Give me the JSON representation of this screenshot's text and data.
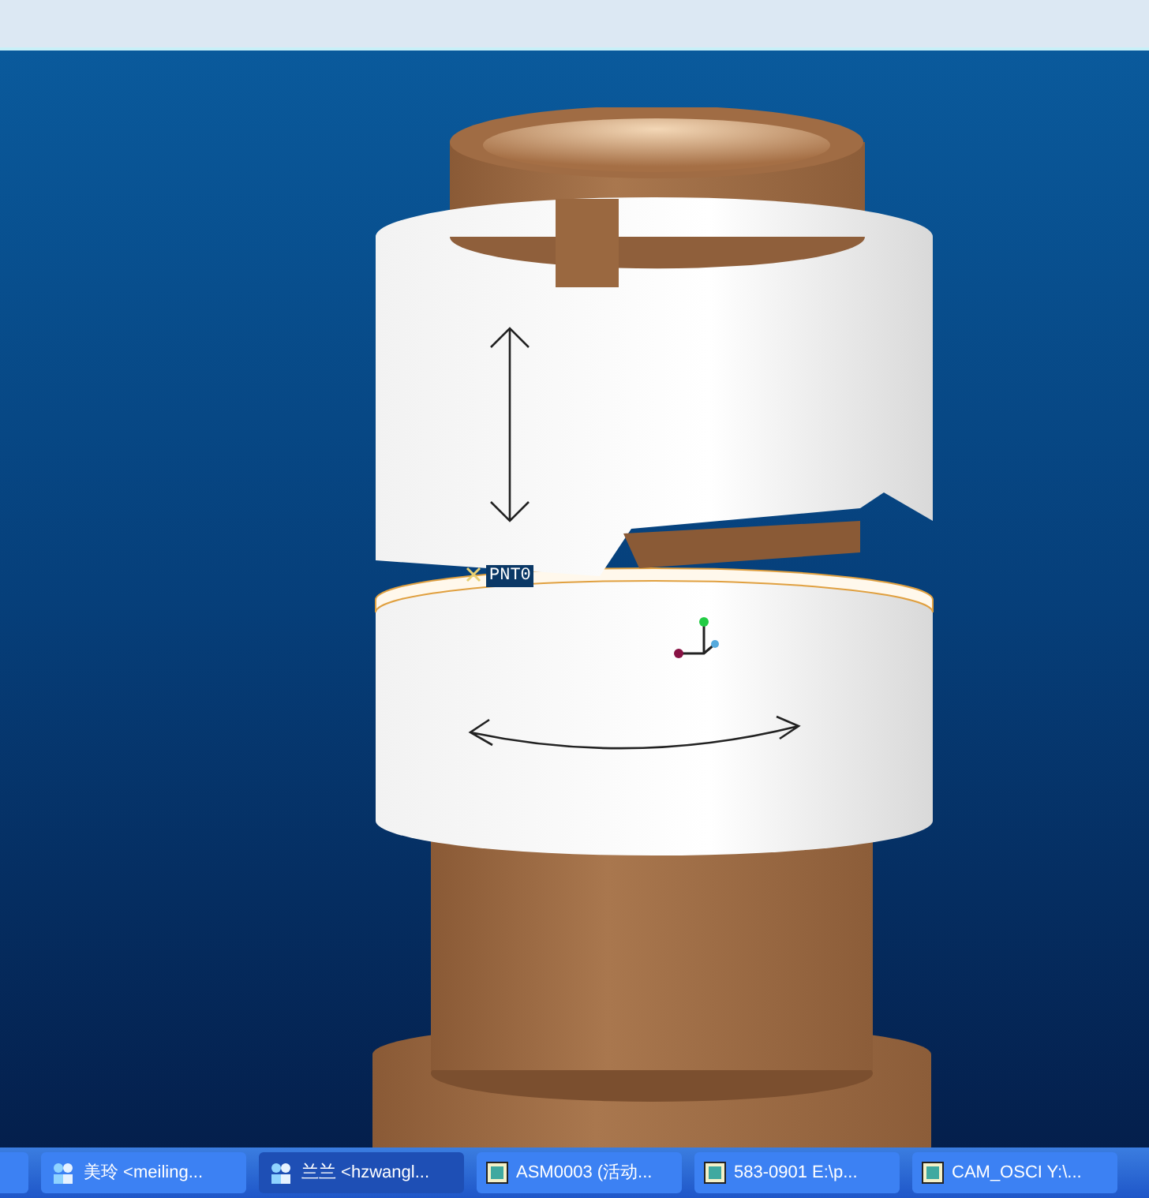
{
  "viewport": {
    "point_label": "PNT0"
  },
  "taskbar": {
    "items": [
      {
        "kind": "partial"
      },
      {
        "label": "美玲 <meiling...",
        "kind": "chat"
      },
      {
        "label": "兰兰 <hzwangl...",
        "kind": "chat"
      },
      {
        "label": "ASM0003 (活动...",
        "kind": "window"
      },
      {
        "label": "583-0901 E:\\p...",
        "kind": "window"
      },
      {
        "label": "CAM_OSCI Y:\\...",
        "kind": "window"
      }
    ]
  }
}
